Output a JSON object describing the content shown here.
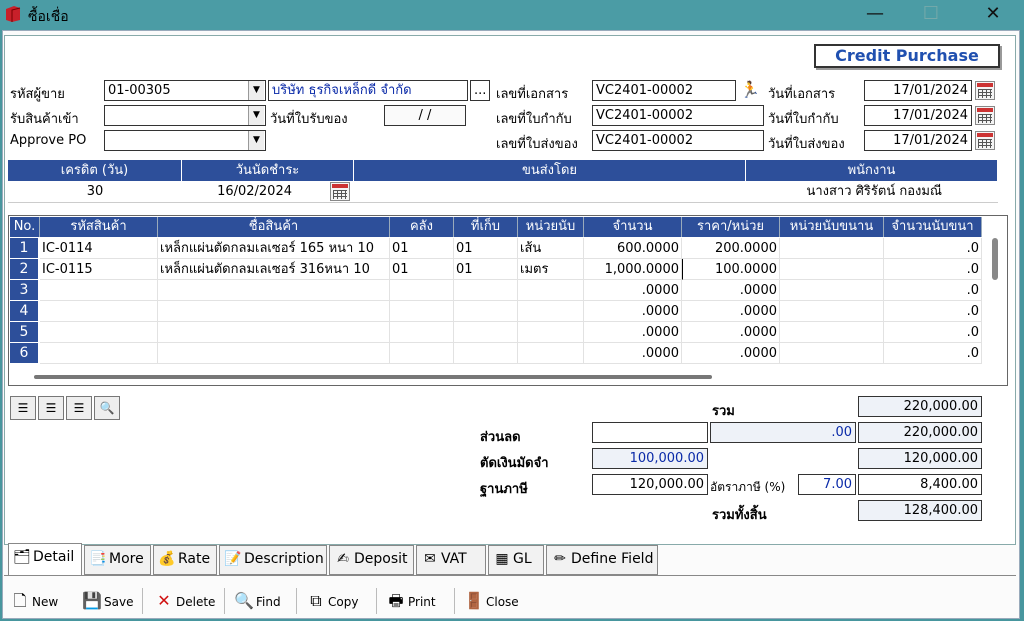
{
  "window": {
    "title": "ซื้อเชื่อ",
    "controls": [
      "—",
      "☐",
      "✕"
    ]
  },
  "mode_label": "Credit Purchase",
  "form": {
    "vendor_code_label": "รหัสผู้ขาย",
    "vendor_code": "01-00305",
    "vendor_name": "บริษัท ธุรกิจเหล็กดี จำกัด",
    "browse_btn": "...",
    "receive_label": "รับสินค้าเข้า",
    "receive_value": "",
    "approve_label": "Approve PO",
    "approve_value": "",
    "receipt_date_label": "วันที่ใบรับของ",
    "receipt_date": "/ /",
    "doc_no_label": "เลขที่เอกสาร",
    "doc_no": "VC2401-00002",
    "tax_inv_label": "เลขที่ใบกำกับ",
    "tax_inv": "VC2401-00002",
    "delivery_no_label": "เลขที่ใบส่งของ",
    "delivery_no": "VC2401-00002",
    "doc_date_label": "วันที่เอกสาร",
    "doc_date": "17/01/2024",
    "tax_inv_date_label": "วันที่ใบกำกับ",
    "tax_inv_date": "17/01/2024",
    "delivery_date_label": "วันที่ใบส่งของ",
    "delivery_date": "17/01/2024"
  },
  "terms": {
    "headers": [
      "เครดิต (วัน)",
      "วันนัดชำระ",
      "ขนส่งโดย",
      "พนักงาน"
    ],
    "credit_days": "30",
    "due_date": "16/02/2024",
    "shipping": "",
    "employee": "นางสาว ศิริรัตน์ กองมณี"
  },
  "grid": {
    "columns": [
      "No.",
      "รหัสสินค้า",
      "ชื่อสินค้า",
      "คลัง",
      "ที่เก็บ",
      "หน่วยนับ",
      "จำนวน",
      "ราคา/หน่วย",
      "หน่วยนับขนาน",
      "จำนวนนับขนา"
    ],
    "rows": [
      {
        "no": "1",
        "code": "IC-0114",
        "name": "เหล็กแผ่นตัดกลมเลเซอร์ 165 หนา 10",
        "wh": "01",
        "loc": "01",
        "unit": "เส้น",
        "qty": "600.0000",
        "price": "200.0000",
        "punit": "",
        "pqty": ".0"
      },
      {
        "no": "2",
        "code": "IC-0115",
        "name": "เหล็กแผ่นตัดกลมเลเซอร์ 316หนา 10",
        "wh": "01",
        "loc": "01",
        "unit": "เมตร",
        "qty": "1,000.0000",
        "price": "100.0000",
        "punit": "",
        "pqty": ".0"
      },
      {
        "no": "3",
        "code": "",
        "name": "",
        "wh": "",
        "loc": "",
        "unit": "",
        "qty": ".0000",
        "price": ".0000",
        "punit": "",
        "pqty": ".0"
      },
      {
        "no": "4",
        "code": "",
        "name": "",
        "wh": "",
        "loc": "",
        "unit": "",
        "qty": ".0000",
        "price": ".0000",
        "punit": "",
        "pqty": ".0"
      },
      {
        "no": "5",
        "code": "",
        "name": "",
        "wh": "",
        "loc": "",
        "unit": "",
        "qty": ".0000",
        "price": ".0000",
        "punit": "",
        "pqty": ".0"
      },
      {
        "no": "6",
        "code": "",
        "name": "",
        "wh": "",
        "loc": "",
        "unit": "",
        "qty": ".0000",
        "price": ".0000",
        "punit": "",
        "pqty": ".0"
      }
    ]
  },
  "totals": {
    "sum_label": "รวม",
    "sum": "220,000.00",
    "discount_label": "ส่วนลด",
    "discount_input": "",
    "discount_amount": ".00",
    "after_discount": "220,000.00",
    "deposit_label": "ตัดเงินมัดจำ",
    "deposit": "100,000.00",
    "after_deposit": "120,000.00",
    "tax_base_label": "ฐานภาษี",
    "tax_base": "120,000.00",
    "vat_rate_label": "อัตราภาษี (%)",
    "vat_rate": "7.00",
    "vat_amount": "8,400.00",
    "grand_label": "รวมทั้งสิ้น",
    "grand_total": "128,400.00"
  },
  "tabs": [
    "Detail",
    "More",
    "Rate",
    "Description",
    "Deposit",
    "VAT",
    "GL",
    "Define Field"
  ],
  "toolbar": {
    "new": "New",
    "save": "Save",
    "delete": "Delete",
    "find": "Find",
    "copy": "Copy",
    "print": "Print",
    "close": "Close"
  },
  "colors": {
    "header_blue": "#2d4f9a",
    "title_bar": "#4b9ca5",
    "value_blue": "#0a2aa8",
    "credit_text": "#2050b0"
  }
}
